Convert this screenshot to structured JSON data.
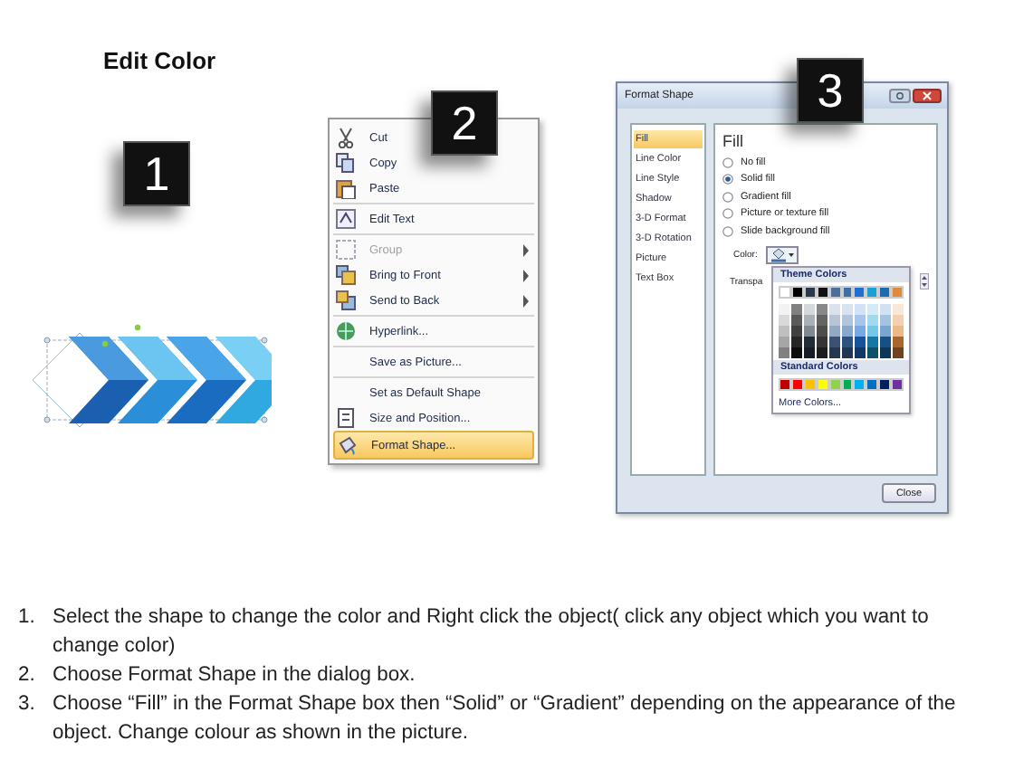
{
  "title": "Edit Color",
  "step_badges": [
    "1",
    "2",
    "3"
  ],
  "context_menu": {
    "items": [
      {
        "label": "Cut",
        "disabled": false,
        "submenu": false,
        "selected": false,
        "separator_after": false
      },
      {
        "label": "Copy",
        "disabled": false,
        "submenu": false,
        "selected": false,
        "separator_after": false
      },
      {
        "label": "Paste",
        "disabled": false,
        "submenu": false,
        "selected": false,
        "separator_after": true
      },
      {
        "label": "Edit Text",
        "disabled": false,
        "submenu": false,
        "selected": false,
        "separator_after": true
      },
      {
        "label": "Group",
        "disabled": true,
        "submenu": true,
        "selected": false,
        "separator_after": false
      },
      {
        "label": "Bring to Front",
        "disabled": false,
        "submenu": true,
        "selected": false,
        "separator_after": false
      },
      {
        "label": "Send to Back",
        "disabled": false,
        "submenu": true,
        "selected": false,
        "separator_after": true
      },
      {
        "label": "Hyperlink...",
        "disabled": false,
        "submenu": false,
        "selected": false,
        "separator_after": true
      },
      {
        "label": "Save as Picture...",
        "disabled": false,
        "submenu": false,
        "selected": false,
        "separator_after": true
      },
      {
        "label": "Set as Default Shape",
        "disabled": false,
        "submenu": false,
        "selected": false,
        "separator_after": false
      },
      {
        "label": "Size and Position...",
        "disabled": false,
        "submenu": false,
        "selected": false,
        "separator_after": false
      },
      {
        "label": "Format Shape...",
        "disabled": false,
        "submenu": false,
        "selected": true,
        "separator_after": false
      }
    ]
  },
  "dialog": {
    "title": "Format Shape",
    "categories": [
      {
        "label": "Fill",
        "selected": true
      },
      {
        "label": "Line Color",
        "selected": false
      },
      {
        "label": "Line Style",
        "selected": false
      },
      {
        "label": "Shadow",
        "selected": false
      },
      {
        "label": "3-D Format",
        "selected": false
      },
      {
        "label": "3-D Rotation",
        "selected": false
      },
      {
        "label": "Picture",
        "selected": false
      },
      {
        "label": "Text Box",
        "selected": false
      }
    ],
    "heading": "Fill",
    "fill_options": [
      {
        "label": "No fill",
        "selected": false
      },
      {
        "label": "Solid fill",
        "selected": true
      },
      {
        "label": "Gradient fill",
        "selected": false
      },
      {
        "label": "Picture or texture fill",
        "selected": false
      },
      {
        "label": "Slide background fill",
        "selected": false
      }
    ],
    "color_label": "Color:",
    "transparency_label": "Transpa",
    "color_popup": {
      "theme_heading": "Theme Colors",
      "theme_colors": [
        {
          "color": "#ffffff"
        },
        {
          "color": "#000000"
        },
        {
          "color": "#2b3a4a"
        },
        {
          "color": "#111111"
        },
        {
          "color": "#4a6f9a"
        },
        {
          "color": "#3b6fa8"
        },
        {
          "color": "#1f6fd0"
        },
        {
          "color": "#1aa0d8"
        },
        {
          "color": "#1e6ab0"
        },
        {
          "color": "#e08a3c"
        }
      ],
      "standard_heading": "Standard Colors",
      "standard_colors": [
        {
          "color": "#c00000"
        },
        {
          "color": "#ff0000"
        },
        {
          "color": "#ffc000"
        },
        {
          "color": "#ffff00"
        },
        {
          "color": "#92d050"
        },
        {
          "color": "#00b050"
        },
        {
          "color": "#00b0f0"
        },
        {
          "color": "#0070c0"
        },
        {
          "color": "#002060"
        },
        {
          "color": "#7030a0"
        }
      ],
      "more_link": "More Colors..."
    },
    "close_button": "Close"
  },
  "instructions": [
    {
      "number": "1.",
      "text": "Select the shape to change the color and Right click the object( click any object which you want to change color)"
    },
    {
      "number": "2.",
      "text": "Choose Format Shape in the dialog box."
    },
    {
      "number": "3.",
      "text": "Choose “Fill” in the Format Shape box then “Solid” or “Gradient” depending on the appearance of the object. Change colour as shown in the picture."
    }
  ]
}
